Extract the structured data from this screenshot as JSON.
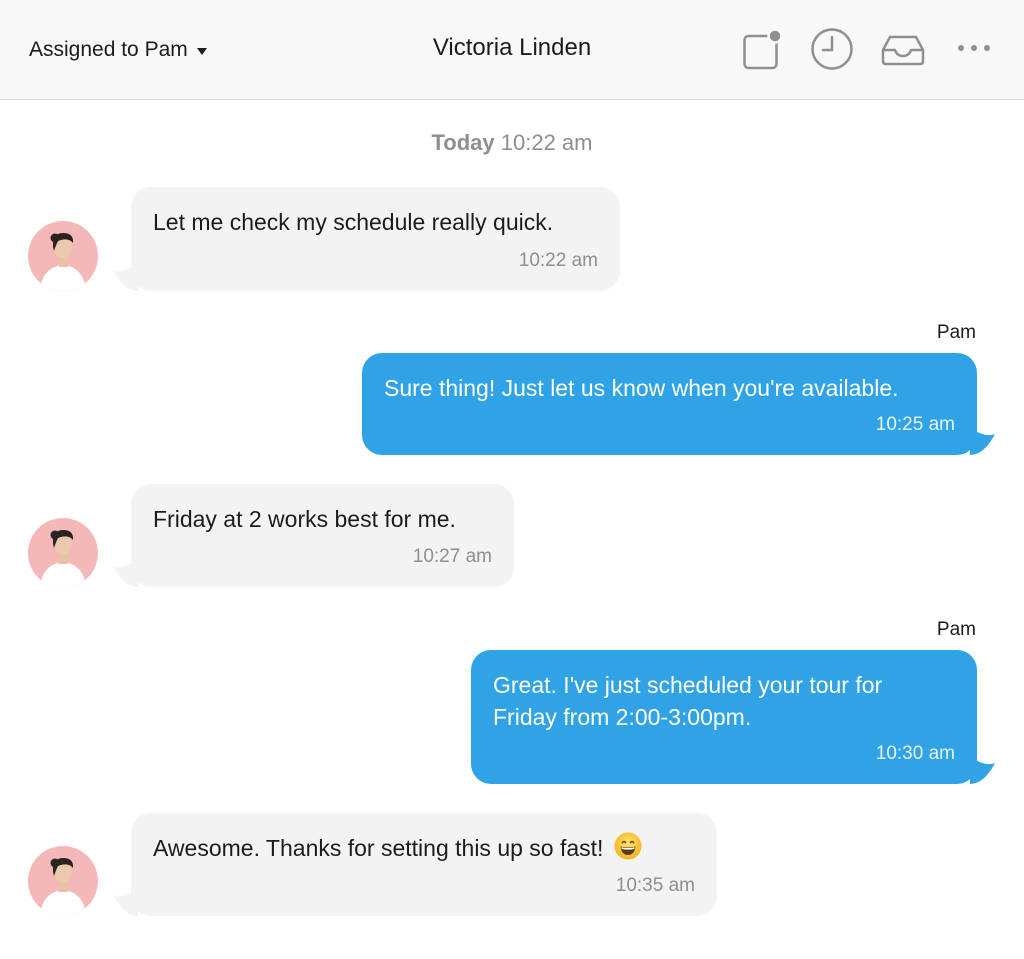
{
  "header": {
    "assigned_label": "Assigned to Pam",
    "contact_name": "Victoria Linden",
    "icons": [
      "note-icon",
      "clock-icon",
      "inbox-icon",
      "more-icon"
    ]
  },
  "conversation": {
    "day_label": "Today",
    "day_time": "10:22 am",
    "messages": [
      {
        "direction": "incoming",
        "text": "Let me check my schedule really quick.",
        "time": "10:22 am"
      },
      {
        "direction": "outgoing",
        "sender": "Pam",
        "text": "Sure thing! Just let us know when you're available.",
        "time": "10:25 am"
      },
      {
        "direction": "incoming",
        "text": "Friday at 2 works best for me.",
        "time": "10:27 am"
      },
      {
        "direction": "outgoing",
        "sender": "Pam",
        "text_line1": "Great. I've just scheduled your tour for",
        "text_line2": "Friday from 2:00-3:00pm.",
        "time": "10:30 am"
      },
      {
        "direction": "incoming",
        "text": "Awesome. Thanks for setting this up so fast!",
        "emoji": "grinning-face-icon",
        "time": "10:35 am"
      }
    ]
  },
  "colors": {
    "outgoing_bubble": "#2fa3e6",
    "incoming_bubble": "#f3f3f3",
    "header_bg": "#f8f8f8",
    "avatar_bg": "#f4b8b8"
  }
}
